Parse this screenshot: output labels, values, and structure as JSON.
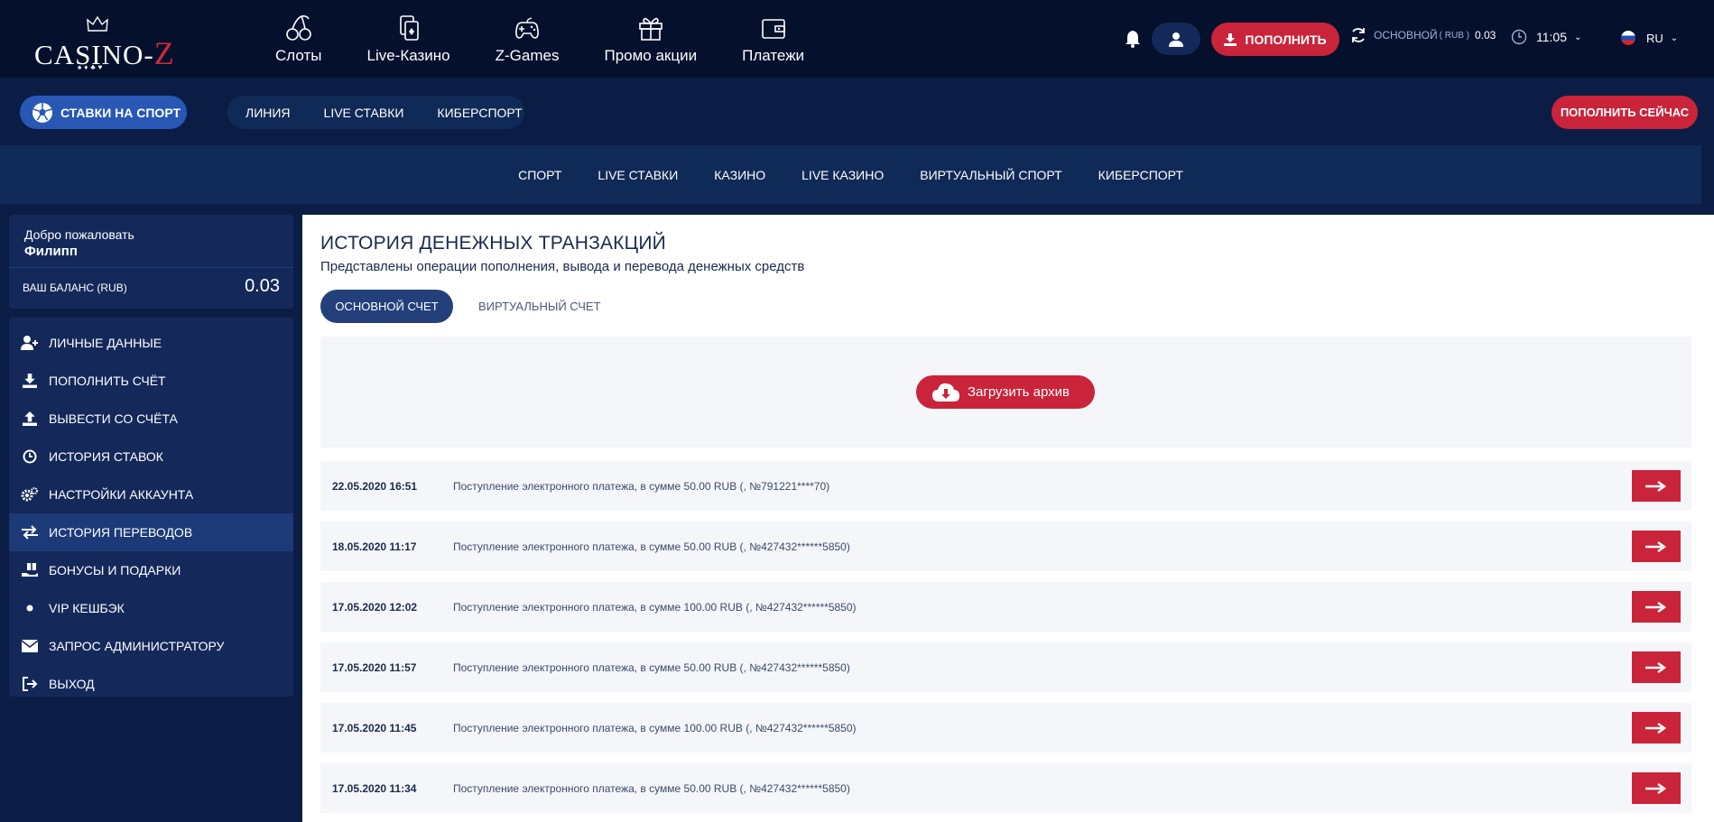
{
  "header": {
    "logo_text_main": "CASINO-",
    "logo_text_accent": "Z",
    "nav": [
      {
        "label": "Слоты",
        "icon": "cherry-icon"
      },
      {
        "label": "Live-Казино",
        "icon": "cards-icon"
      },
      {
        "label": "Z-Games",
        "icon": "gamepad-icon"
      },
      {
        "label": "Промо акции",
        "icon": "gift-icon"
      },
      {
        "label": "Платежи",
        "icon": "wallet-icon"
      }
    ],
    "deposit_label": "ПОПОЛНИТЬ",
    "balance_label": "ОСНОВНОЙ",
    "balance_currency": "( RUB )",
    "balance_value": "0.03",
    "time": "11:05",
    "language": "RU"
  },
  "sportbar": {
    "sport_button": "СТАВКИ НА СПОРТ",
    "links": [
      "ЛИНИЯ",
      "LIVE СТАВКИ",
      "КИБЕРСПОРТ"
    ],
    "deposit_now": "ПОПОЛНИТЬ СЕЙЧАС"
  },
  "categories": [
    "СПОРТ",
    "LIVE СТАВКИ",
    "КАЗИНО",
    "LIVE КАЗИНО",
    "ВИРТУАЛЬНЫЙ СПОРТ",
    "КИБЕРСПОРТ"
  ],
  "sidebar": {
    "welcome": "Добро пожаловать",
    "username": "Филипп",
    "balance_label": "ВАШ БАЛАНС (RUB)",
    "balance_value": "0.03",
    "menu": [
      {
        "label": "ЛИЧНЫЕ ДАННЫЕ",
        "icon": "user-plus-icon"
      },
      {
        "label": "ПОПОЛНИТЬ СЧЁТ",
        "icon": "download-icon"
      },
      {
        "label": "ВЫВЕСТИ СО СЧЁТА",
        "icon": "upload-icon"
      },
      {
        "label": "ИСТОРИЯ СТАВОК",
        "icon": "clock-icon"
      },
      {
        "label": "НАСТРОЙКИ АККАУНТА",
        "icon": "gears-icon"
      },
      {
        "label": "ИСТОРИЯ ПЕРЕВОДОВ",
        "icon": "exchange-icon"
      },
      {
        "label": "БОНУСЫ И ПОДАРКИ",
        "icon": "gift-hand-icon"
      },
      {
        "label": "VIP КЕШБЭК",
        "icon": "dot-icon"
      },
      {
        "label": "ЗАПРОС АДМИНИСТРАТОРУ",
        "icon": "envelope-icon"
      },
      {
        "label": "ВЫХОД",
        "icon": "logout-icon"
      }
    ]
  },
  "content": {
    "title": "ИСТОРИЯ ДЕНЕЖНЫХ ТРАНЗАКЦИЙ",
    "subtitle": "Представлены операции пополнения, вывода и перевода денежных средств",
    "tab_main": "ОСНОВНОЙ СЧЕТ",
    "tab_virtual": "ВИРТУАЛЬНЫЙ СЧЕТ",
    "archive_button": "Загрузить архив",
    "transactions": [
      {
        "date": "22.05.2020 16:51",
        "desc": "Поступление электронного платежа, в сумме 50.00 RUB (, №791221****70)"
      },
      {
        "date": "18.05.2020 11:17",
        "desc": "Поступление электронного платежа, в сумме 50.00 RUB (, №427432******5850)"
      },
      {
        "date": "17.05.2020 12:02",
        "desc": "Поступление электронного платежа, в сумме 100.00 RUB (, №427432******5850)"
      },
      {
        "date": "17.05.2020 11:57",
        "desc": "Поступление электронного платежа, в сумме 50.00 RUB (, №427432******5850)"
      },
      {
        "date": "17.05.2020 11:45",
        "desc": "Поступление электронного платежа, в сумме 100.00 RUB (, №427432******5850)"
      },
      {
        "date": "17.05.2020 11:34",
        "desc": "Поступление электронного платежа, в сумме 50.00 RUB (, №427432******5850)"
      }
    ]
  },
  "colors": {
    "header_bg": "#04102c",
    "page_bg": "#0b1d45",
    "accent_red": "#c9243a",
    "accent_blue": "#2857b6"
  }
}
